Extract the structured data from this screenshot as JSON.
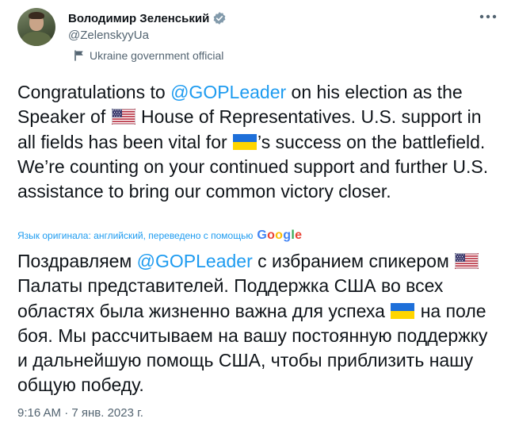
{
  "author": {
    "display_name": "Володимир Зеленський",
    "handle": "@ZelenskyyUa",
    "label": "Ukraine government official",
    "avatar_icon": "avatar-photo",
    "verified_icon": "verified-badge-icon"
  },
  "tweet": {
    "original_segments": [
      {
        "type": "text",
        "text": "Congratulations to "
      },
      {
        "type": "mention",
        "text": "@GOPLeader"
      },
      {
        "type": "text",
        "text": " on his election as the Speaker of "
      },
      {
        "type": "flag",
        "flag": "us"
      },
      {
        "type": "text",
        "text": " House of Representatives. U.S. support in all fields has been vital for "
      },
      {
        "type": "flag",
        "flag": "ua"
      },
      {
        "type": "text",
        "text": "’s success on the battlefield. We’re counting on your continued support and further U.S. assistance to bring our common victory closer."
      }
    ],
    "translation_note": "Язык оригинала: английский, переведено с помощью",
    "translation_provider": "Google",
    "translated_segments": [
      {
        "type": "text",
        "text": "Поздравляем "
      },
      {
        "type": "mention",
        "text": "@GOPLeader"
      },
      {
        "type": "text",
        "text": " с избранием спикером "
      },
      {
        "type": "flag",
        "flag": "us"
      },
      {
        "type": "text",
        "text": " Палаты представителей. Поддержка США во всех областях была жизненно важна для успеха "
      },
      {
        "type": "flag",
        "flag": "ua"
      },
      {
        "type": "text",
        "text": " на поле боя. Мы рассчитываем на вашу постоянную поддержку и дальнейшую помощь США, чтобы приблизить нашу общую победу."
      }
    ],
    "timestamp": "9:16 AM · 7 янв. 2023 г."
  },
  "icons": {
    "more": "more-options-icon",
    "government": "government-building-icon",
    "flag_us": "us-flag-icon",
    "flag_ua": "ukraine-flag-icon"
  },
  "colors": {
    "accent": "#1d9bf0",
    "text": "#0f1419",
    "secondary": "#536471",
    "badge": "#829aab",
    "google_blue": "#4285f4",
    "google_red": "#ea4335",
    "google_yellow": "#fbbc05",
    "google_green": "#34a853"
  }
}
